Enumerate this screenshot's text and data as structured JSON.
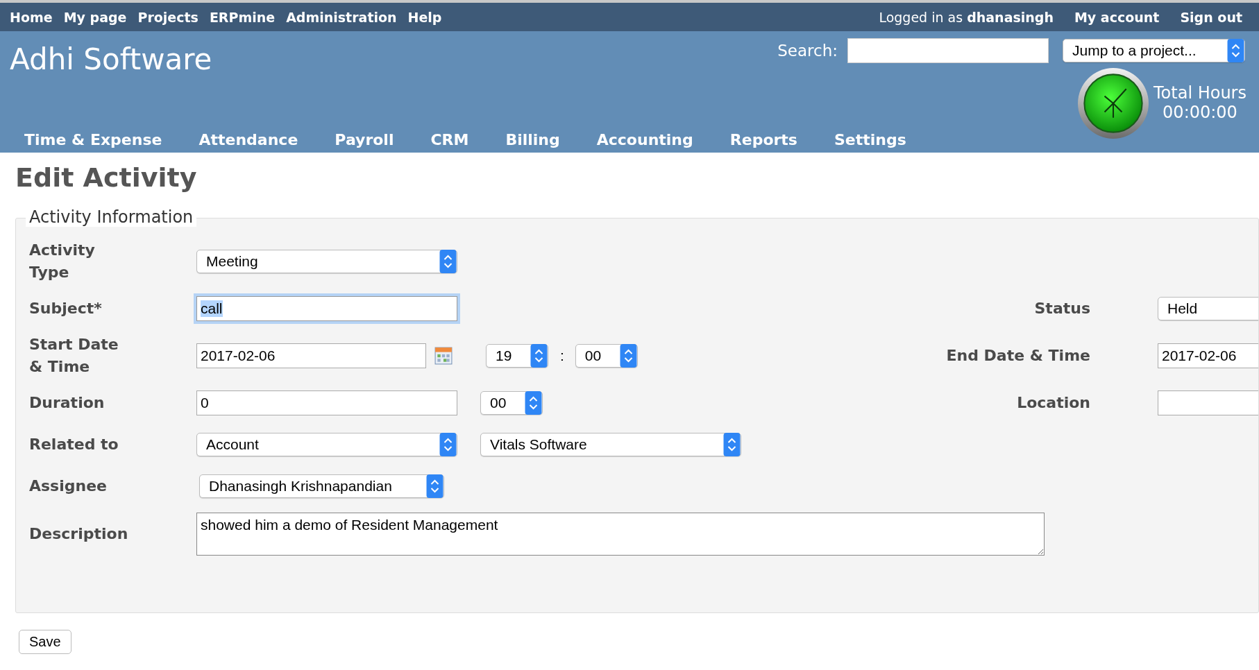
{
  "top_menu": {
    "items": [
      "Home",
      "My page",
      "Projects",
      "ERPmine",
      "Administration",
      "Help"
    ],
    "logged_in": "Logged in as **dhanasingh**",
    "account_links": [
      "My account",
      "Sign out"
    ]
  },
  "header": {
    "title": "Adhi Software",
    "search_label": "Search:",
    "project_jump": "Jump to a project...",
    "timer": {
      "label": "Total Hours",
      "value": "00:00:00"
    }
  },
  "tabs": [
    {
      "label": "Time & Expense",
      "selected": false
    },
    {
      "label": "Attendance",
      "selected": false
    },
    {
      "label": "Payroll",
      "selected": false
    },
    {
      "label": "CRM",
      "selected": false
    },
    {
      "label": "Billing",
      "selected": false
    },
    {
      "label": "Accounting",
      "selected": false
    },
    {
      "label": "Reports",
      "selected": false
    },
    {
      "label": "Settings",
      "selected": false
    }
  ],
  "page_title": "Edit Activity",
  "fieldset": {
    "legend": "Activity Information",
    "rows": [
      {
        "label": "Activity Type",
        "controls": [
          {
            "kind": "select",
            "value": "Meeting"
          }
        ]
      },
      {
        "label": "Subject*",
        "controls": [
          {
            "kind": "text",
            "value": "call",
            "focused": true
          }
        ],
        "right": {
          "label": "Status",
          "controls": [
            {
              "kind": "select",
              "value": "Held"
            }
          ]
        }
      },
      {
        "label": "Start Date & Time",
        "controls": [
          {
            "kind": "text",
            "value": "2017-02-06"
          },
          {
            "kind": "calendar"
          },
          {
            "kind": "select",
            "value": "19"
          },
          {
            "kind": "separator",
            "text": ":"
          },
          {
            "kind": "select",
            "value": "00"
          }
        ],
        "right": {
          "label": "End Date & Time",
          "controls": [
            {
              "kind": "text",
              "value": "2017-02-06"
            }
          ]
        }
      },
      {
        "label": "Duration",
        "controls": [
          {
            "kind": "text",
            "value": "0"
          },
          {
            "kind": "select",
            "value": "00"
          }
        ],
        "right": {
          "label": "Location",
          "controls": [
            {
              "kind": "text"
            }
          ]
        }
      },
      {
        "label": "Related to",
        "controls": [
          {
            "kind": "select",
            "value": "Account"
          },
          {
            "kind": "select",
            "value": "Vitals Software"
          }
        ]
      },
      {
        "label": "Assignee",
        "controls": [
          {
            "kind": "select",
            "value": "Dhanasingh Krishnapandian"
          }
        ]
      },
      {
        "label": "Description",
        "controls": [
          {
            "kind": "textarea",
            "value": "showed him a demo of Resident Management"
          }
        ]
      }
    ]
  },
  "save_button": "Save"
}
